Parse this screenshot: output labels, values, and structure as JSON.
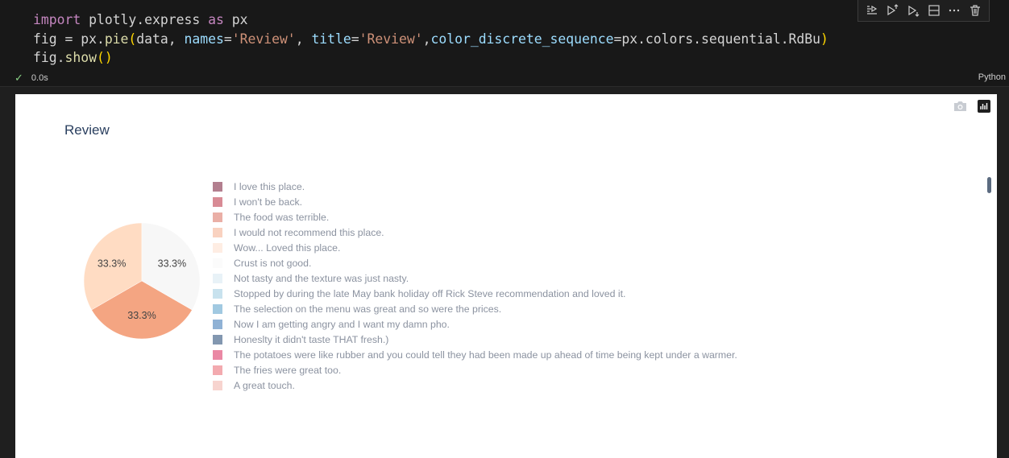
{
  "cell": {
    "code_tokens": {
      "import_kw": "import",
      "module": " plotly.express ",
      "as_kw": "as",
      "alias": " px",
      "fig_assign": "fig = px.",
      "pie_fn": "pie",
      "open_paren": "(",
      "args_a": "data, ",
      "names_kw": "names",
      "eq1": "=",
      "names_val": "'Review'",
      "comma1": ", ",
      "title_kw": "title",
      "eq2": "=",
      "title_val": "'Review'",
      "comma2": ",",
      "color_kw": "color_discrete_sequence",
      "eq3": "=",
      "color_val": "px.colors.sequential.RdBu",
      "close_paren": ")",
      "show_line": "fig.",
      "show_fn": "show",
      "show_parens": "()"
    },
    "status_time": "0.0s",
    "language": "Python",
    "toolbar": [
      "run-by-line-icon",
      "execute-above-icon",
      "execute-below-icon",
      "split-cell-icon",
      "more-icon",
      "delete-icon"
    ]
  },
  "chart_data": {
    "type": "pie",
    "title": "Review",
    "slices": [
      {
        "label": "I love this place.",
        "value": 33.3,
        "display": "33.3%",
        "color": "#ffdcc3"
      },
      {
        "label": "I won't be back.",
        "value": 33.3,
        "display": "33.3%",
        "color": "#f4a582"
      },
      {
        "label": "The food was terrible.",
        "value": 33.3,
        "display": "33.3%",
        "color": "#f7f7f7"
      }
    ],
    "legend": [
      {
        "label": "I love this place.",
        "color": "#67001f"
      },
      {
        "label": "I won't be back.",
        "color": "#b2182b"
      },
      {
        "label": "The food was terrible.",
        "color": "#d6604d"
      },
      {
        "label": "I would not recommend this place.",
        "color": "#f4a582"
      },
      {
        "label": "Wow... Loved this place.",
        "color": "#fddbc7"
      },
      {
        "label": "Crust is not good.",
        "color": "#f7f7f7"
      },
      {
        "label": "Not tasty and the texture was just nasty.",
        "color": "#d1e5f0"
      },
      {
        "label": "Stopped by during the late May bank holiday off Rick Steve recommendation and loved it.",
        "color": "#92c5de"
      },
      {
        "label": "The selection on the menu was great and so were the prices.",
        "color": "#4393c3"
      },
      {
        "label": "Now I am getting angry and I want my damn pho.",
        "color": "#2166ac"
      },
      {
        "label": "Honeslty it didn't taste THAT fresh.)",
        "color": "#053061"
      },
      {
        "label": "The potatoes were like rubber and you could tell they had been made up ahead of time being kept under a warmer.",
        "color": "#d6114a"
      },
      {
        "label": "The fries were great too.",
        "color": "#e8555f"
      },
      {
        "label": "A great touch.",
        "color": "#f0a9a0"
      }
    ]
  }
}
